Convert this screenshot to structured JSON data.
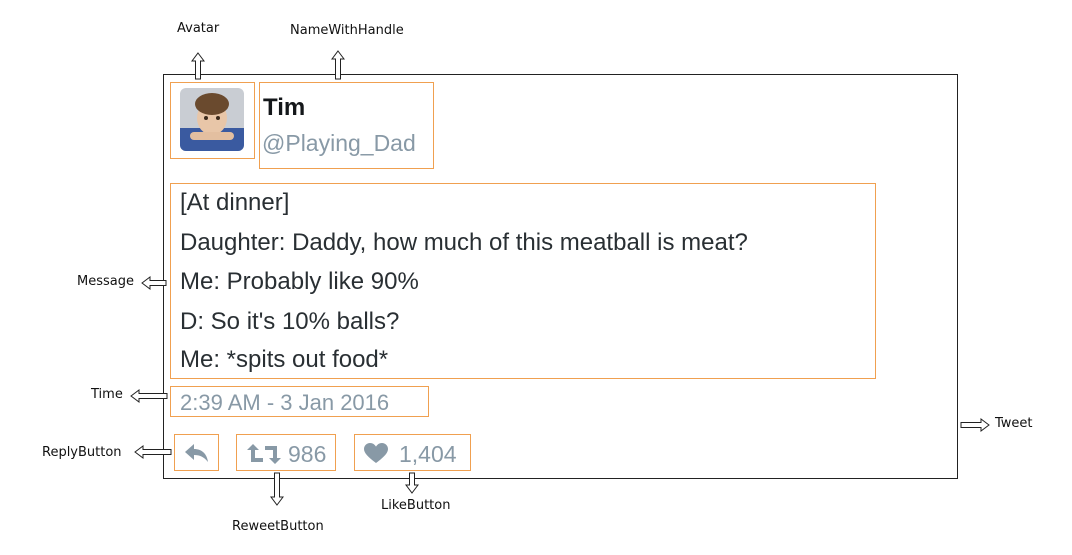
{
  "labels": {
    "avatar": "Avatar",
    "name_with_handle": "NameWithHandle",
    "message": "Message",
    "time": "Time",
    "reply_button": "ReplyButton",
    "reweet_button": "ReweetButton",
    "like_button": "LikeButton",
    "tweet": "Tweet"
  },
  "tweet": {
    "name": "Tim",
    "handle": "@Playing_Dad",
    "message_lines": [
      "[At dinner]",
      "Daughter: Daddy, how much of this meatball is meat?",
      "Me: Probably like 90%",
      "D: So it's 10% balls?",
      "Me: *spits out food*"
    ],
    "time": "2:39 AM - 3 Jan 2016",
    "retweet_count": "986",
    "like_count": "1,404"
  },
  "icons": {
    "reply": "reply-icon",
    "retweet": "retweet-icon",
    "like": "heart-icon",
    "avatar": "avatar-photo"
  },
  "colors": {
    "highlight": "#f0a050",
    "muted": "#8899a6",
    "text": "#292f33",
    "icon": "#8899a6"
  }
}
